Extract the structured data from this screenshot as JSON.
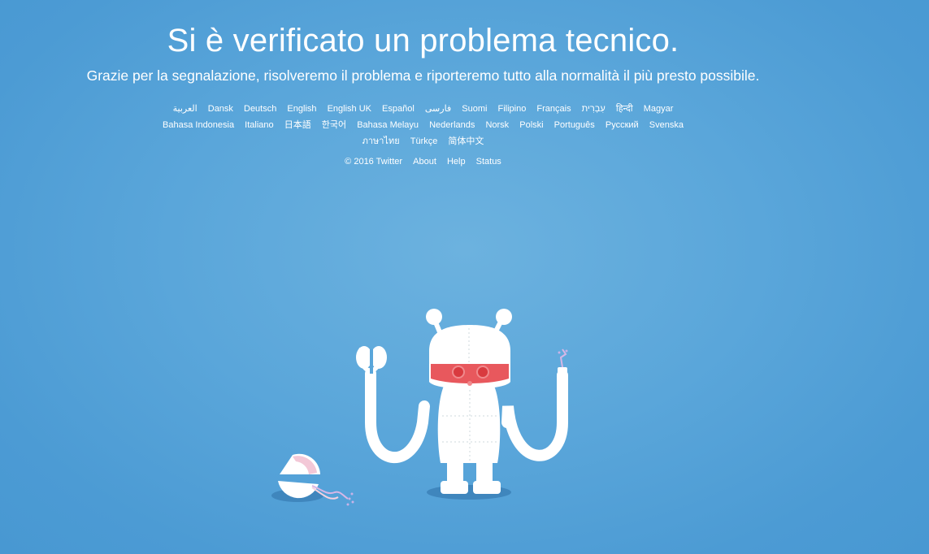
{
  "page": {
    "title": "Si è verificato un problema tecnico.",
    "subtitle": "Grazie per la segnalazione, risolveremo il problema e riporteremo tutto alla normalità il più presto possibile."
  },
  "languages": {
    "row1": [
      "العربية",
      "Dansk",
      "Deutsch",
      "English",
      "English UK",
      "Español",
      "فارسی",
      "Suomi",
      "Filipino",
      "Français",
      "עִבְרִית",
      "हिन्दी",
      "Magyar"
    ],
    "row2": [
      "Bahasa Indonesia",
      "Italiano",
      "日本語",
      "한국어",
      "Bahasa Melayu",
      "Nederlands",
      "Norsk",
      "Polski",
      "Português",
      "Русский",
      "Svenska"
    ],
    "row3": [
      "ภาษาไทย",
      "Türkçe",
      "简体中文"
    ]
  },
  "footer": {
    "copyright": "© 2016 Twitter",
    "about": "About",
    "help": "Help",
    "status": "Status"
  },
  "colors": {
    "background": "#5aa6da",
    "robot_body": "#ffffff",
    "robot_visor": "#e8585d",
    "shadow": "#3f86bd"
  },
  "illustration": {
    "icon": "broken-robot-illustration"
  }
}
